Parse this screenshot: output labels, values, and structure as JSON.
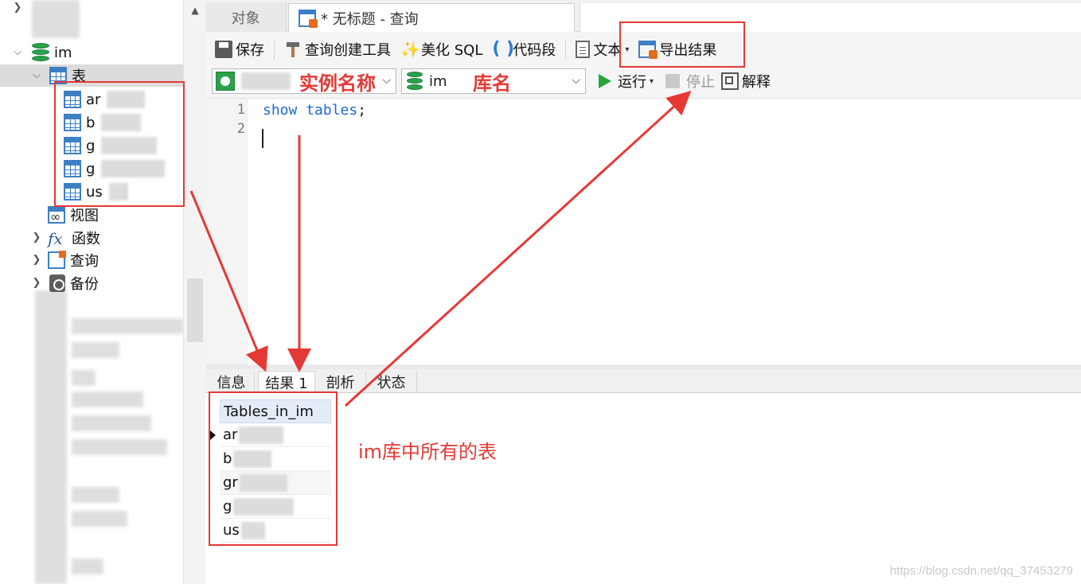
{
  "tree": {
    "db_name": "im",
    "tables_label": "表",
    "tables": [
      "ar",
      "b",
      "g",
      "g",
      "us"
    ],
    "views_label": "视图",
    "functions_label": "函数",
    "queries_label": "查询",
    "backups_label": "备份",
    "fx_glyph": "fx"
  },
  "tabs": {
    "objects": "对象",
    "query_title": "* 无标题 - 查询"
  },
  "toolbar": {
    "save": "保存",
    "query_builder": "查询创建工具",
    "beautify_sql": "美化 SQL",
    "code_snippet": "代码段",
    "text": "文本",
    "export_results": "导出结果"
  },
  "toolbar2": {
    "instance_annotation": "实例名称",
    "database_value": "im",
    "database_annotation": "库名",
    "run": "运行",
    "stop": "停止",
    "explain": "解释"
  },
  "editor": {
    "line_numbers": [
      "1",
      "2"
    ],
    "sql_keyword1": "show",
    "sql_keyword2": "tables",
    "sql_rest": ";"
  },
  "result_tabs": [
    "信息",
    "结果 1",
    "剖析",
    "状态"
  ],
  "results": {
    "column_header": "Tables_in_im",
    "rows": [
      "ar",
      "b",
      "gr",
      "g",
      "us"
    ]
  },
  "annotation": {
    "result_note": "im库中所有的表"
  },
  "watermark": "https://blog.csdn.net/qq_37453279",
  "colors": {
    "annotation_red": "#e53935",
    "keyword_blue": "#1c69d6",
    "db_green": "#2aa14a"
  }
}
